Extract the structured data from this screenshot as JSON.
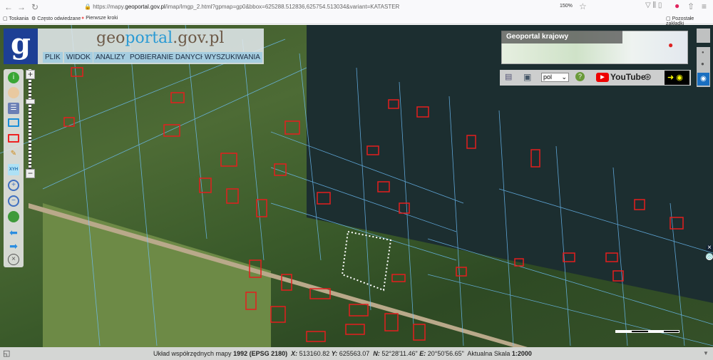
{
  "browser": {
    "url_prefix": "https://mapy.",
    "url_domain": "geoportal.gov.pl",
    "url_rest": "/imap/Imgp_2.html?gpmap=gp0&bbox=625288.512836,625754.513034&variant=KATASTER",
    "zoom": "150%",
    "bookmarks": [
      "Toskania",
      "Często odwiedzane",
      "Pierwsze kroki"
    ],
    "other_bookmarks": "Pozostałe zakładki"
  },
  "header": {
    "logo_letter": "g",
    "title_pre": "geo",
    "title_accent": "portal",
    "title_post": ".gov.pl",
    "menu": [
      "PLIK",
      "WIDOK",
      "ANALIZY",
      "POBIERANIE DANYCH",
      "WYSZUKIWANIA"
    ]
  },
  "toolbar": {
    "tools": [
      "info-icon",
      "hand-icon",
      "legend-icon",
      "select-blue-icon",
      "select-red-icon",
      "pencil-icon",
      "xyh-icon",
      "zoom-in-icon",
      "zoom-out-icon",
      "globe-icon",
      "back-arrow-icon",
      "forward-arrow-icon",
      "close-circle-icon"
    ],
    "xyh_label": "XYH"
  },
  "minimap": {
    "title": "Geoportal krajowy"
  },
  "right_tools": {
    "language": "pol",
    "youtube": "YouTube"
  },
  "status": {
    "label": "Układ współrzędnych mapy",
    "system": "1992 (EPSG 2180)",
    "x_label": "X:",
    "x": "513160.82",
    "y_label": "Y:",
    "y": "625563.07",
    "n_label": "N:",
    "n": "52°28'11.46\"",
    "e_label": "E:",
    "e": "20°50'56.65\"",
    "scale_label": "Aktualna Skala",
    "scale": "1:2000"
  }
}
